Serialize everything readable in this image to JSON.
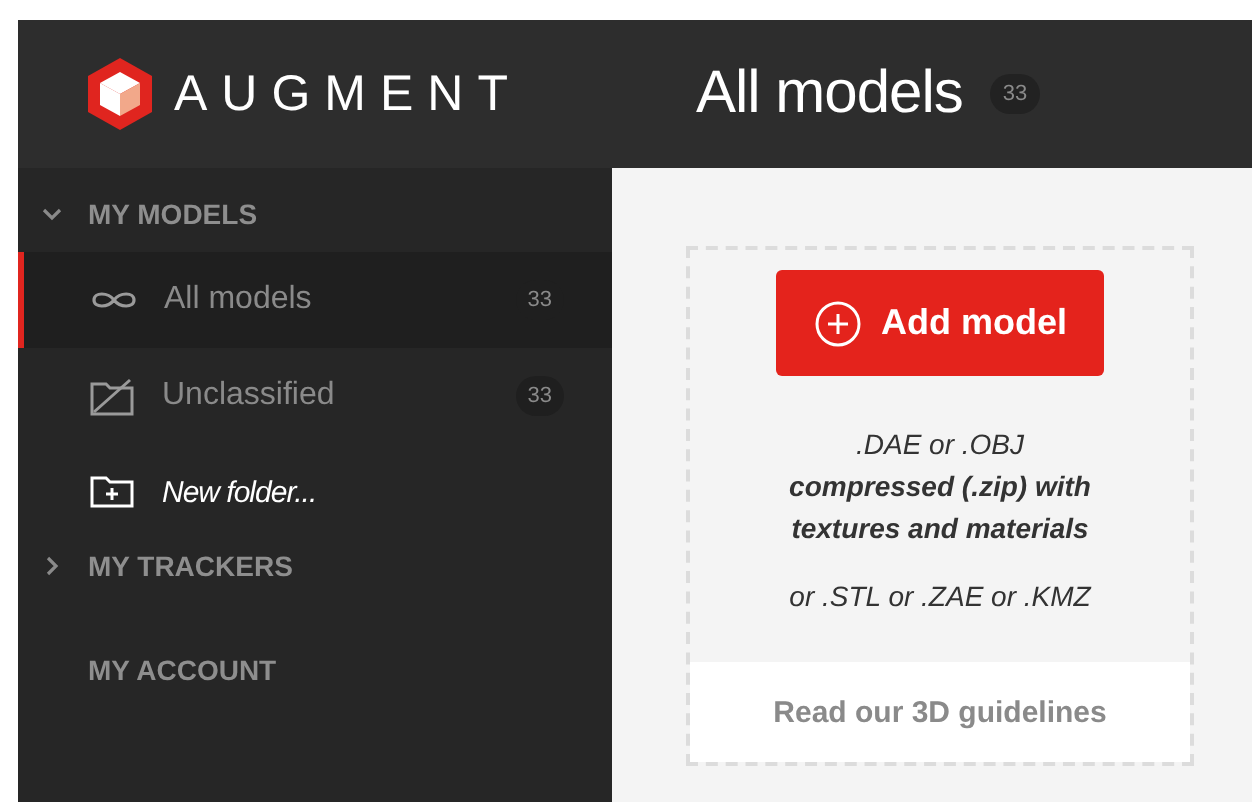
{
  "brand": {
    "name": "AUGMENT"
  },
  "header": {
    "title": "All models",
    "count": "33"
  },
  "sidebar": {
    "sections": [
      {
        "label": "MY MODELS",
        "kind": "group",
        "expanded": true,
        "items": [
          {
            "label": "All models",
            "kind": "all",
            "count": "33",
            "selected": true
          },
          {
            "label": "Unclassified",
            "kind": "unclassified",
            "count": "33",
            "selected": false
          },
          {
            "label": "New folder...",
            "kind": "new-folder",
            "selected": false
          }
        ]
      },
      {
        "label": "MY TRACKERS",
        "kind": "group",
        "expanded": false
      },
      {
        "label": "MY ACCOUNT",
        "kind": "link"
      }
    ]
  },
  "upload_card": {
    "button": "Add model",
    "formats": [
      {
        "text": ".DAE or .OBJ",
        "emphasis": false
      },
      {
        "text": "compressed (.zip) with textures and materials",
        "emphasis": true
      }
    ],
    "alternatives": "or .STL or .ZAE or .KMZ",
    "link": "Read our 3D guidelines"
  }
}
